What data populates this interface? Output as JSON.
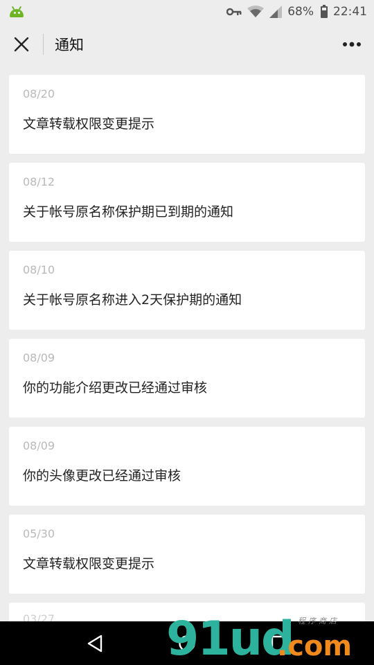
{
  "status_bar": {
    "battery_percent": "68%",
    "battery_level": 0.68,
    "time": "22:41",
    "icons": [
      "android-icon",
      "key-icon",
      "wifi-icon",
      "signal-icon",
      "battery-icon"
    ]
  },
  "header": {
    "title": "通知",
    "left_icon": "close-icon",
    "right_icon": "more-icon"
  },
  "notifications": [
    {
      "date": "08/20",
      "text": "文章转载权限变更提示"
    },
    {
      "date": "08/12",
      "text": "关于帐号原名称保护期已到期的通知"
    },
    {
      "date": "08/10",
      "text": "关于帐号原名称进入2天保护期的通知"
    },
    {
      "date": "08/09",
      "text": "你的功能介绍更改已经通过审核"
    },
    {
      "date": "08/09",
      "text": "你的头像更改已经通过审核"
    },
    {
      "date": "05/30",
      "text": "文章转载权限变更提示"
    },
    {
      "date": "03/27",
      "text": ""
    }
  ],
  "nav_bar": {
    "icons": [
      "back-icon",
      "home-icon",
      "recents-icon"
    ]
  },
  "watermark": {
    "brand_main": "91ud",
    "brand_suffix": ".com",
    "tagline": "程序商店"
  },
  "colors": {
    "background": "#ededed",
    "card": "#ffffff",
    "date_text": "#b9b9b9",
    "accent_android": "#6eb526",
    "watermark_green": "#2db39d",
    "watermark_orange": "#f08a1c"
  }
}
